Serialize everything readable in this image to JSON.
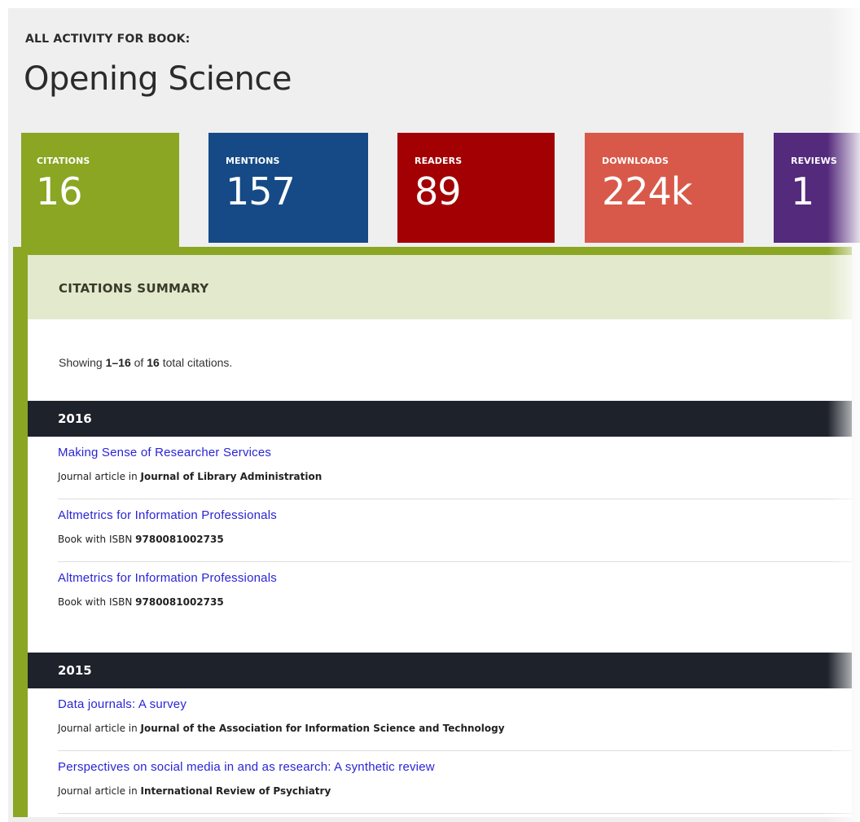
{
  "header": {
    "pretitle": "ALL ACTIVITY FOR BOOK:",
    "title": "Opening Science"
  },
  "tabs": [
    {
      "label": "CITATIONS",
      "value": "16",
      "color": "#8aa623",
      "active": true
    },
    {
      "label": "MENTIONS",
      "value": "157",
      "color": "#164a86"
    },
    {
      "label": "READERS",
      "value": "89",
      "color": "#a20003"
    },
    {
      "label": "DOWNLOADS",
      "value": "224k",
      "color": "#d8594a"
    },
    {
      "label": "REVIEWS",
      "value": "1",
      "color": "#542a7c"
    }
  ],
  "summary": {
    "title": "CITATIONS SUMMARY",
    "showing_prefix": "Showing",
    "range": "1–16",
    "of": "of",
    "total": "16",
    "suffix": "total citations."
  },
  "years": [
    {
      "year": "2016",
      "items": [
        {
          "title": "Making Sense of Researcher Services",
          "type": "Journal article in",
          "venue": "Journal of Library Administration"
        },
        {
          "title": "Altmetrics for Information Professionals",
          "type": "Book with ISBN",
          "venue": "9780081002735"
        },
        {
          "title": "Altmetrics for Information Professionals",
          "type": "Book with ISBN",
          "venue": "9780081002735"
        }
      ]
    },
    {
      "year": "2015",
      "items": [
        {
          "title": "Data journals: A survey",
          "type": "Journal article in",
          "venue": "Journal of the Association for Information Science and Technology"
        },
        {
          "title": "Perspectives on social media in and as research: A synthetic review",
          "type": "Journal article in",
          "venue": "International Review of Psychiatry"
        }
      ]
    }
  ]
}
